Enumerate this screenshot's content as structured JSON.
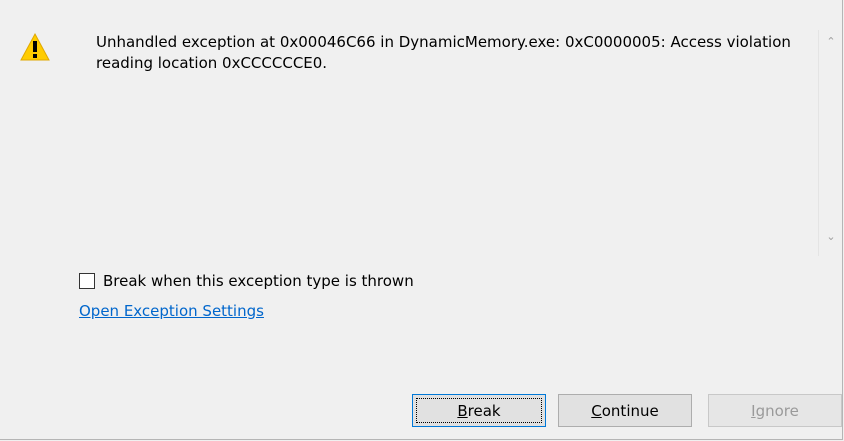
{
  "dialog": {
    "icon": "warning-icon",
    "message": "Unhandled exception at 0x00046C66 in DynamicMemory.exe: 0xC0000005: Access violation reading location 0xCCCCCCE0.",
    "break_checkbox_label": "Break when this exception type is thrown",
    "break_checkbox_checked": false,
    "settings_link": "Open Exception Settings",
    "buttons": {
      "break": "Break",
      "continue": "Continue",
      "ignore": "Ignore"
    }
  },
  "colors": {
    "background": "#f0f0f0",
    "link": "#0066cc",
    "warning": "#ffcc00",
    "default_button_border": "#0078d7"
  }
}
